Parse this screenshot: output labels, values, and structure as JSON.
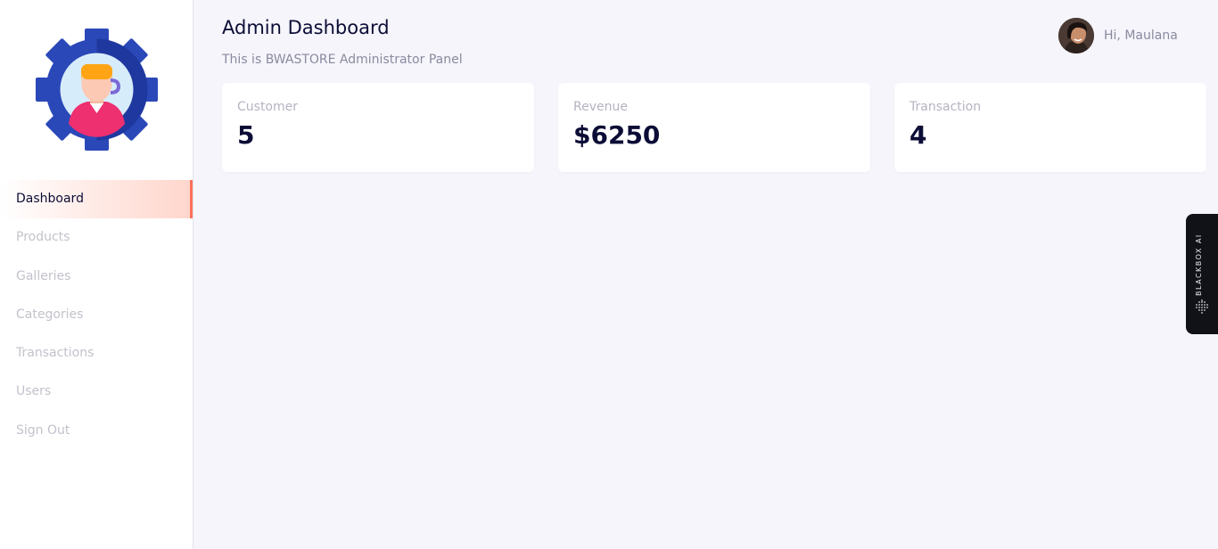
{
  "header": {
    "title": "Admin Dashboard",
    "subtitle": "This is BWASTORE Administrator Panel",
    "greeting": "Hi, Maulana"
  },
  "sidebar": {
    "logo_icon": "admin-gear-icon",
    "items": [
      {
        "label": "Dashboard",
        "active": true
      },
      {
        "label": "Products"
      },
      {
        "label": "Galleries"
      },
      {
        "label": "Categories"
      },
      {
        "label": "Transactions"
      },
      {
        "label": "Users"
      },
      {
        "label": "Sign Out"
      }
    ]
  },
  "stats": [
    {
      "label": "Customer",
      "value": "5"
    },
    {
      "label": "Revenue",
      "value": "$6250"
    },
    {
      "label": "Transaction",
      "value": "4"
    }
  ],
  "blackbox": {
    "label": "BLACKBOX AI"
  },
  "colors": {
    "accent": "#ff7158",
    "primary_text": "#0c0d36",
    "muted_text": "#c2c2cc",
    "logo_blue": "#2b4dbf",
    "background": "#f5f5fb"
  }
}
